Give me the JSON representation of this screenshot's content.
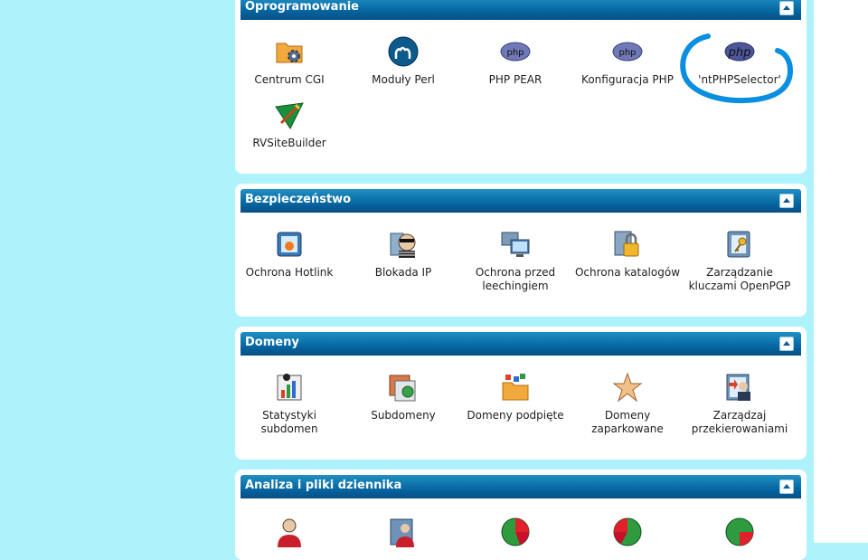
{
  "sections": [
    {
      "title": "Oprogramowanie",
      "items": [
        {
          "label": "Centrum CGI",
          "icon": "cgi-folder-gear-icon"
        },
        {
          "label": "Moduły Perl",
          "icon": "perl-camel-icon"
        },
        {
          "label": "PHP PEAR",
          "icon": "php-logo-icon"
        },
        {
          "label": "Konfiguracja PHP",
          "icon": "php-logo-icon"
        },
        {
          "label": "'ntPHPSelector'",
          "icon": "php-logo-icon"
        },
        {
          "label": "RVSiteBuilder",
          "icon": "rvsitebuilder-icon"
        }
      ]
    },
    {
      "title": "Bezpieczeństwo",
      "items": [
        {
          "label": "Ochrona Hotlink",
          "icon": "hotlink-icon"
        },
        {
          "label": "Blokada IP",
          "icon": "burglar-icon"
        },
        {
          "label": "Ochrona przed leechingiem",
          "icon": "monitors-icon"
        },
        {
          "label": "Ochrona katalogów",
          "icon": "padlock-icon"
        },
        {
          "label": "Zarządzanie kluczami OpenPGP",
          "icon": "key-icon"
        }
      ]
    },
    {
      "title": "Domeny",
      "items": [
        {
          "label": "Statystyki subdomen",
          "icon": "subdomain-stats-icon"
        },
        {
          "label": "Subdomeny",
          "icon": "subdomains-icon"
        },
        {
          "label": "Domeny podpięte",
          "icon": "addon-domains-icon"
        },
        {
          "label": "Domeny zaparkowane",
          "icon": "starfish-icon"
        },
        {
          "label": "Zarządzaj przekierowaniami",
          "icon": "redirect-icon"
        }
      ]
    },
    {
      "title": "Analiza i pliki dziennika",
      "items": [
        {
          "icon": "user-icon"
        },
        {
          "icon": "visitors-icon"
        },
        {
          "icon": "pie-chart-icon"
        },
        {
          "icon": "pie-chart-icon"
        },
        {
          "icon": "pie-chart-icon"
        }
      ]
    }
  ],
  "annotation": {
    "color": "#0a8fe0"
  },
  "colors": {
    "background": "#aef2fb",
    "header": "#04609a"
  }
}
